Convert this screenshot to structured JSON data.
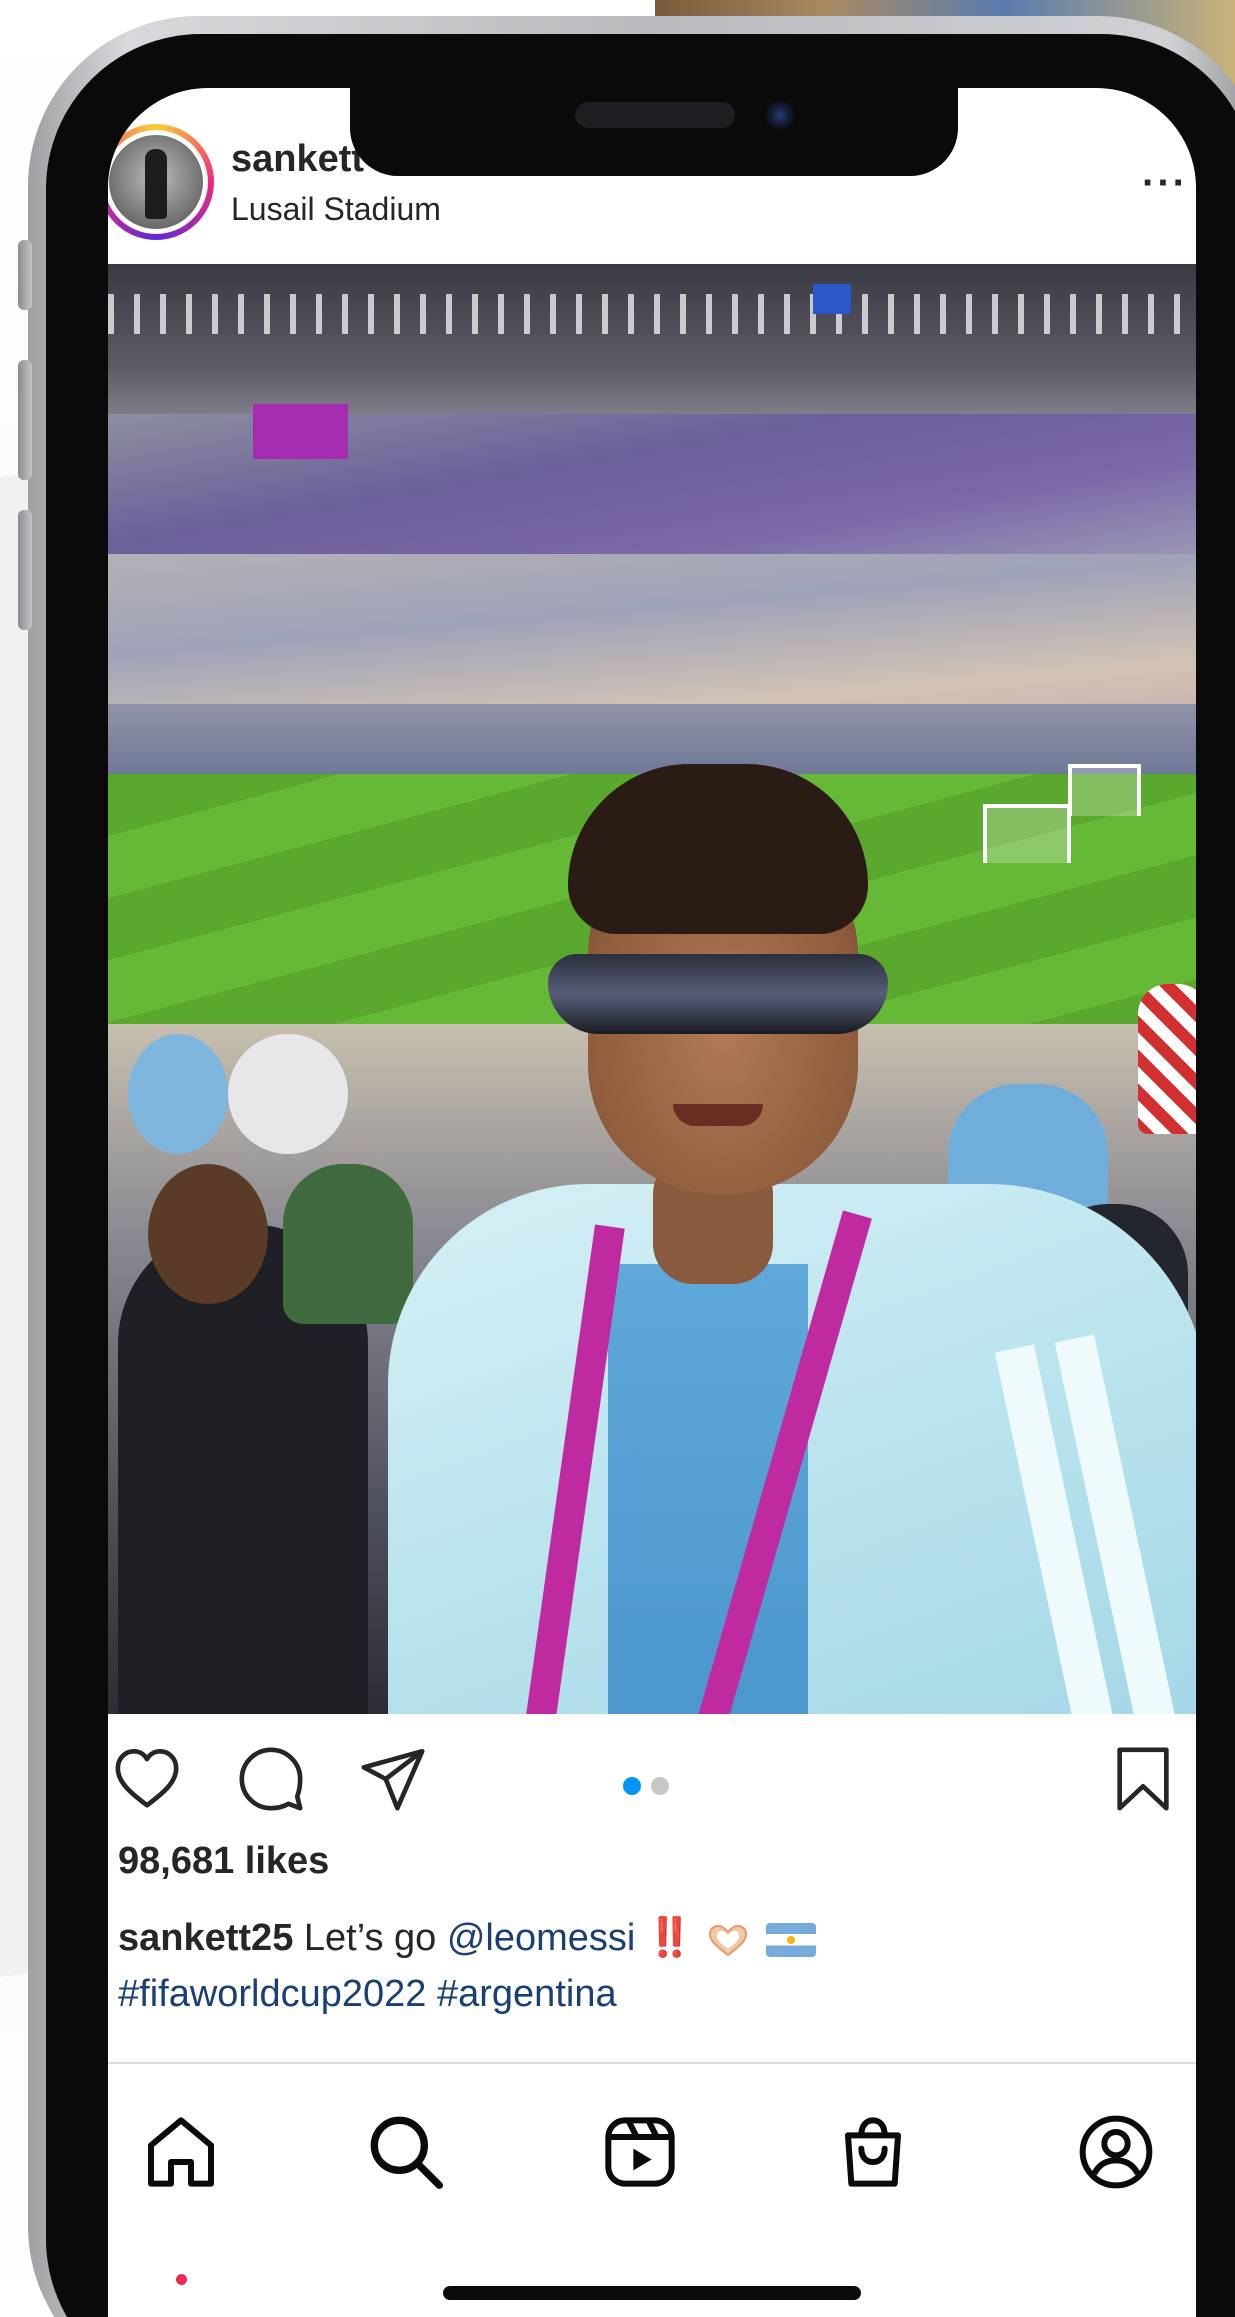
{
  "post": {
    "username": "sankett25",
    "username_visible": "sankett",
    "location": "Lusail Stadium",
    "likes": "98,681 likes",
    "caption": {
      "user": "sankett25",
      "text": "Let’s go",
      "mention": "@leomessi",
      "emoji_1": "‼️",
      "emoji_2": "🫶",
      "emoji_3": "🇦🇷",
      "hashtags": "#fifaworldcup2022 #argentina"
    },
    "carousel": {
      "total": 2,
      "active": 1
    }
  },
  "icons": {
    "more": "more-icon",
    "like": "heart-icon",
    "comment": "comment-icon",
    "share": "send-icon",
    "save": "bookmark-icon",
    "tabs": [
      "home-icon",
      "search-icon",
      "reels-icon",
      "shop-icon",
      "profile-icon"
    ]
  },
  "colors": {
    "text": "#262626",
    "link": "#1a3f74",
    "carousel_active": "#0095f6",
    "carousel_inactive": "#c7c7c7",
    "notification_dot": "#ed2a51"
  }
}
